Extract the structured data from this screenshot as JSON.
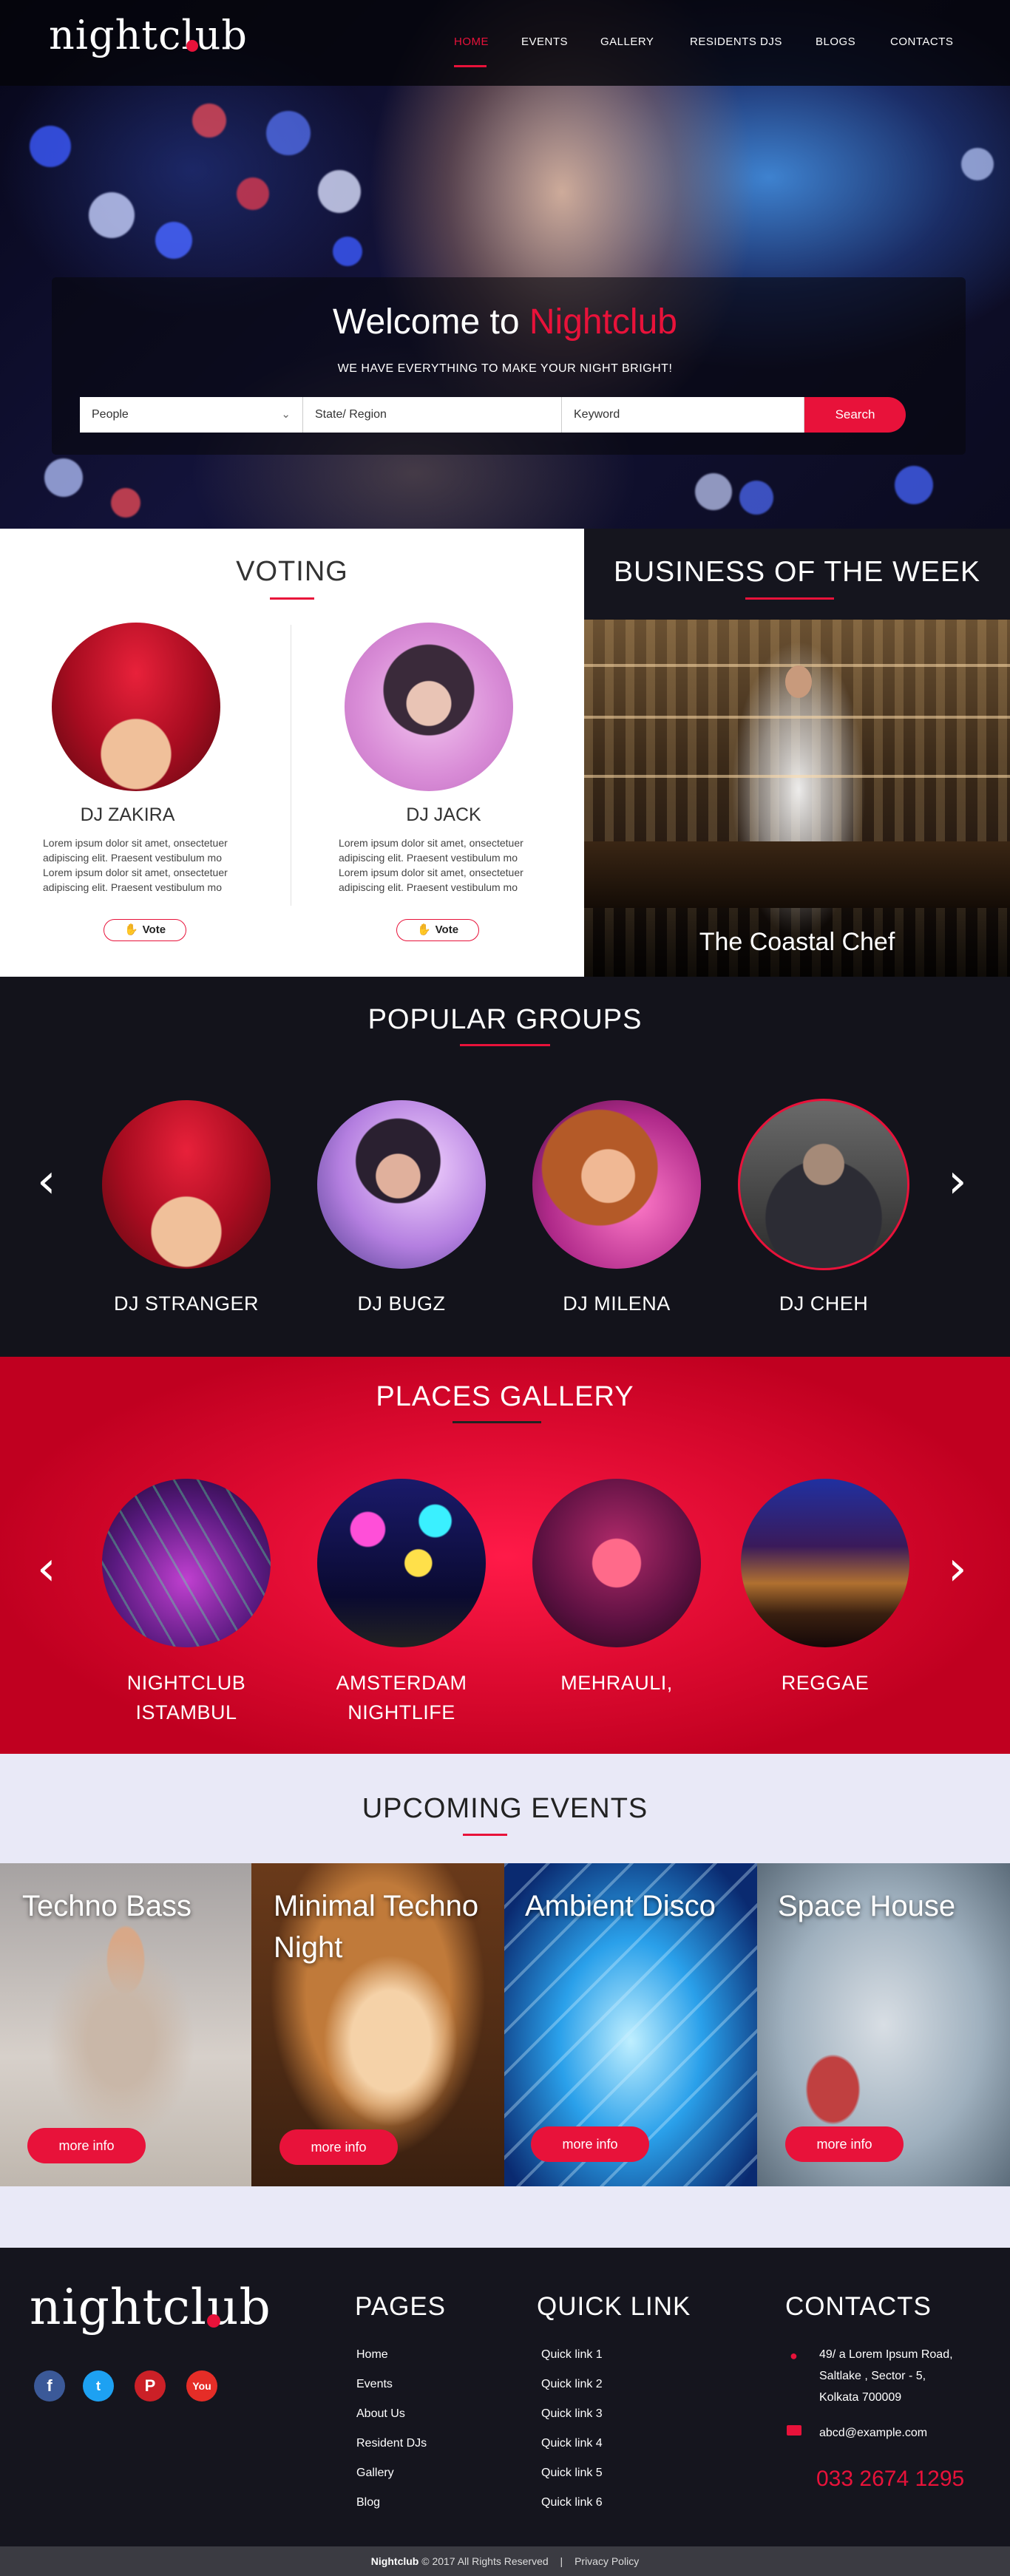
{
  "brand": {
    "logo": "nightclub",
    "accent": "#e8123a"
  },
  "nav": {
    "items": [
      "HOME",
      "EVENTS",
      "GALLERY",
      "RESIDENTS DJS",
      "BLOGS",
      "CONTACTS"
    ],
    "active": "HOME"
  },
  "hero": {
    "title_prefix": "Welcome to ",
    "title_highlight": "Nightclub",
    "subtitle": "WE HAVE EVERYTHING TO MAKE YOUR NIGHT BRIGHT!",
    "search": {
      "people": "People",
      "region": "State/ Region",
      "keyword": "Keyword",
      "button": "Search"
    }
  },
  "voting": {
    "title": "VOTING",
    "djs": [
      {
        "name": "DJ ZAKIRA",
        "text": "Lorem ipsum dolor sit amet, onsectetuer adipiscing elit. Praesent  vestibulum mo Lorem ipsum dolor sit amet, onsectetuer adipiscing elit. Praesent  vestibulum mo",
        "vote": "Vote"
      },
      {
        "name": "DJ JACK",
        "text": "Lorem ipsum dolor sit amet, onsectetuer adipiscing elit. Praesent  vestibulum mo Lorem ipsum dolor sit amet, onsectetuer adipiscing elit. Praesent  vestibulum mo",
        "vote": "Vote"
      }
    ]
  },
  "business": {
    "title": "BUSINESS OF THE WEEK",
    "caption": "The Coastal Chef"
  },
  "popular": {
    "title": "POPULAR GROUPS",
    "groups": [
      "DJ STRANGER",
      "DJ BUGZ",
      "DJ MILENA",
      "DJ CHEH"
    ]
  },
  "places": {
    "title": "PLACES GALLERY",
    "items": [
      {
        "line1": "NIGHTCLUB",
        "line2": "ISTAMBUL"
      },
      {
        "line1": "AMSTERDAM",
        "line2": "NIGHTLIFE"
      },
      {
        "line1": "MEHRAULI,",
        "line2": ""
      },
      {
        "line1": "REGGAE",
        "line2": ""
      }
    ]
  },
  "upcoming": {
    "title": "UPCOMING EVENTS",
    "events": [
      {
        "title": "Techno Bass",
        "button": "more info"
      },
      {
        "title": "Minimal Techno Night",
        "button": "more info"
      },
      {
        "title": "Ambient Disco",
        "button": "more info"
      },
      {
        "title": "Space House",
        "button": "more info"
      }
    ]
  },
  "footer": {
    "pages_title": "PAGES",
    "pages": [
      "Home",
      "Events",
      "About Us",
      "Resident DJs",
      "Gallery",
      "Blog"
    ],
    "quick_title": "QUICK LINK",
    "quick": [
      "Quick link 1",
      "Quick link 2",
      "Quick link 3",
      "Quick link 4",
      "Quick link 5",
      "Quick link 6"
    ],
    "contacts_title": "CONTACTS",
    "address": [
      "49/ a Lorem Ipsum Road,",
      "Saltlake , Sector - 5,",
      "Kolkata 700009"
    ],
    "email": "abcd@example.com",
    "phone": "033 2674 1295",
    "social": [
      "facebook-icon",
      "twitter-icon",
      "pinterest-icon",
      "youtube-icon"
    ],
    "copyright_brand": "Nightclub",
    "copyright": " © 2017 All Rights Reserved",
    "separator": "|",
    "privacy": "Privacy Policy"
  }
}
